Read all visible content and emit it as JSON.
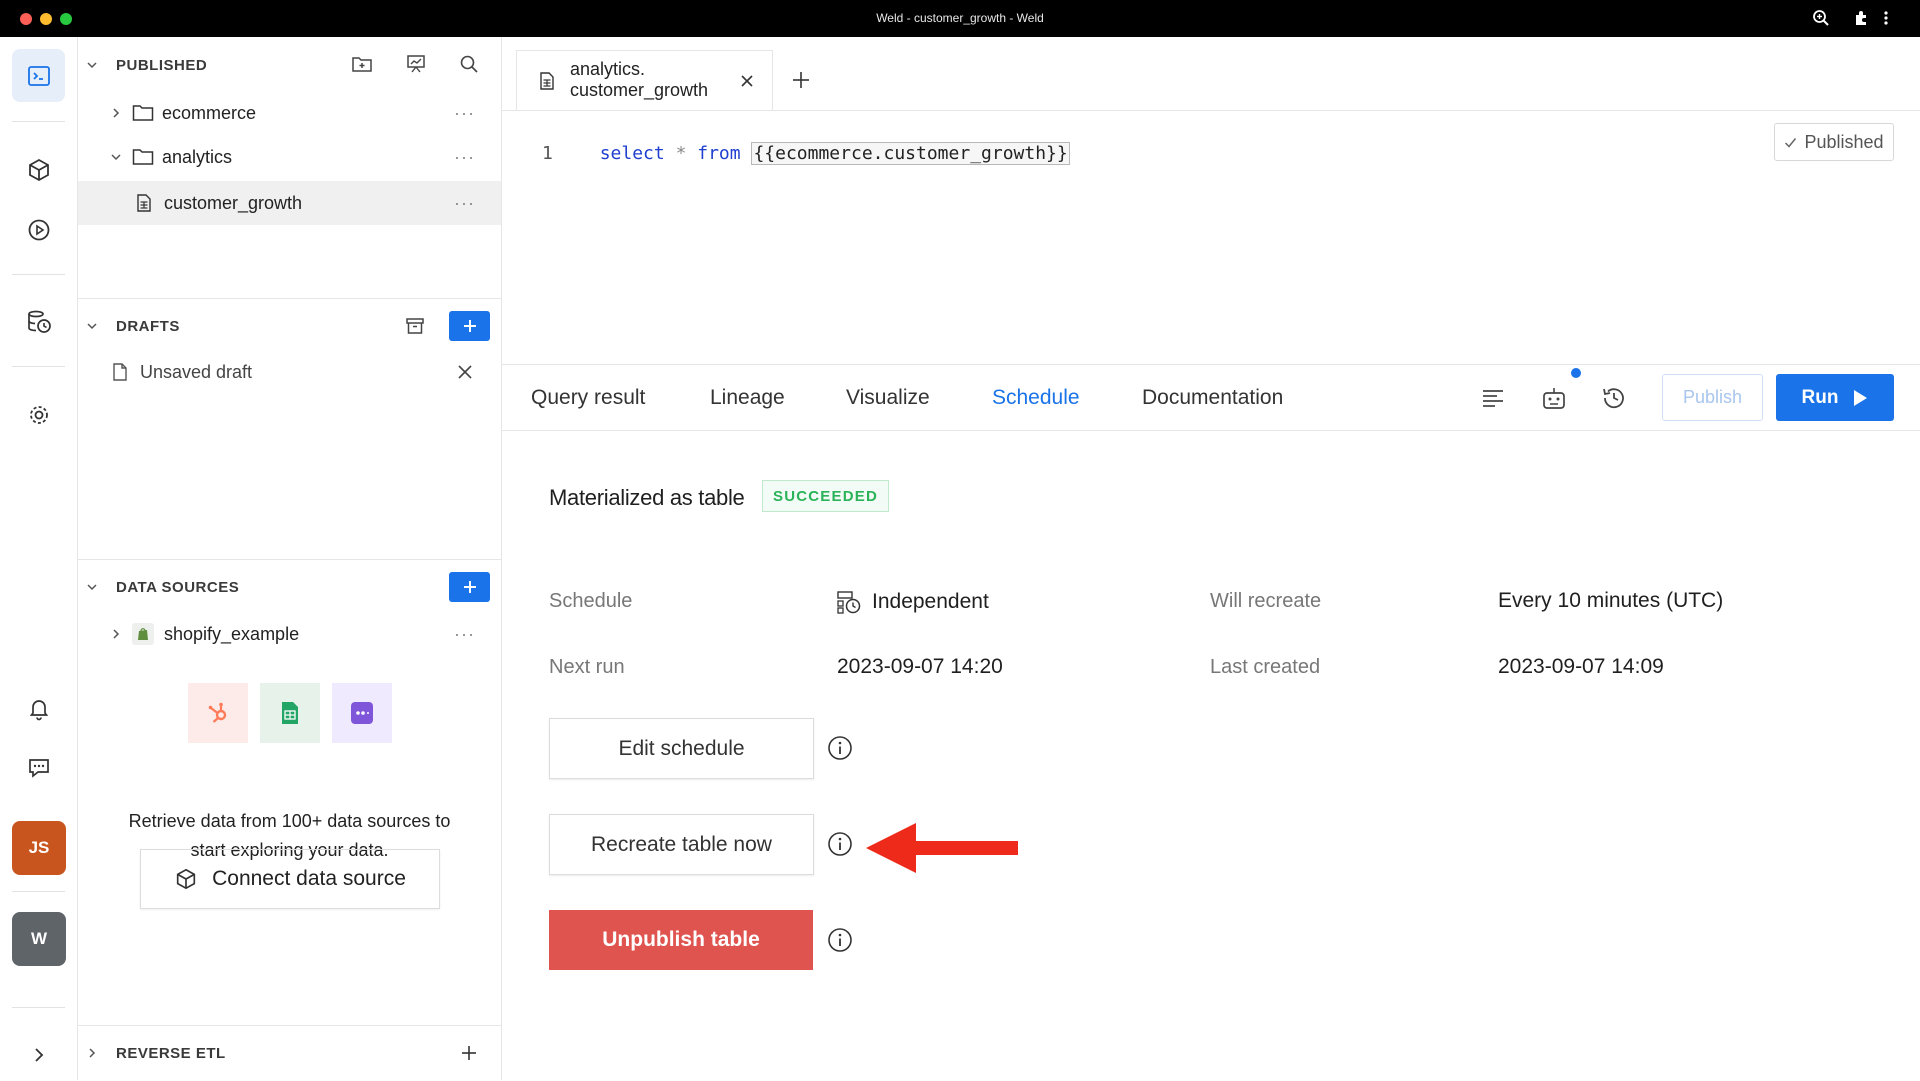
{
  "window": {
    "title": "Weld - customer_growth - Weld"
  },
  "colors": {
    "accent": "#1a73e8",
    "success": "#2bb35a",
    "danger": "#e05450",
    "arrow": "#ee2a1a",
    "avatar_js": "#c8551e",
    "avatar_w": "#5f6469"
  },
  "rail": {
    "items": [
      "terminal-icon",
      "cube-icon",
      "play-circle-icon",
      "database-clock-icon",
      "gear-icon",
      "bell-icon",
      "chat-icon"
    ],
    "avatar_user": "JS",
    "avatar_workspace": "W"
  },
  "sidebar": {
    "published": {
      "title": "PUBLISHED",
      "items": [
        {
          "label": "ecommerce"
        },
        {
          "label": "analytics"
        },
        {
          "label": "customer_growth"
        }
      ]
    },
    "drafts": {
      "title": "DRAFTS",
      "items": [
        {
          "label": "Unsaved draft"
        }
      ]
    },
    "data_sources": {
      "title": "DATA SOURCES",
      "items": [
        {
          "label": "shopify_example"
        }
      ],
      "promo_line1": "Retrieve data from 100+ data sources to",
      "promo_line2": "start exploring your data.",
      "connect_label": "Connect data source"
    },
    "reverse_etl": {
      "title": "REVERSE ETL"
    }
  },
  "editor": {
    "tab_line1": "analytics.",
    "tab_line2": "customer_growth",
    "line_number": "1",
    "code_kw1": "select",
    "code_op": "*",
    "code_kw2": "from",
    "code_ref": "{{ecommerce.customer_growth}}",
    "published_label": "Published"
  },
  "subtabs": {
    "items": [
      "Query result",
      "Lineage",
      "Visualize",
      "Schedule",
      "Documentation"
    ],
    "active": "Schedule",
    "publish_label": "Publish",
    "run_label": "Run"
  },
  "schedule": {
    "title": "Materialized as table",
    "status": "SUCCEEDED",
    "schedule_label": "Schedule",
    "schedule_value": "Independent",
    "will_recreate_label": "Will recreate",
    "will_recreate_value": "Every 10 minutes (UTC)",
    "next_run_label": "Next run",
    "next_run_value": "2023-09-07 14:20",
    "last_created_label": "Last created",
    "last_created_value": "2023-09-07 14:09",
    "edit_label": "Edit schedule",
    "recreate_label": "Recreate table now",
    "unpublish_label": "Unpublish table"
  }
}
